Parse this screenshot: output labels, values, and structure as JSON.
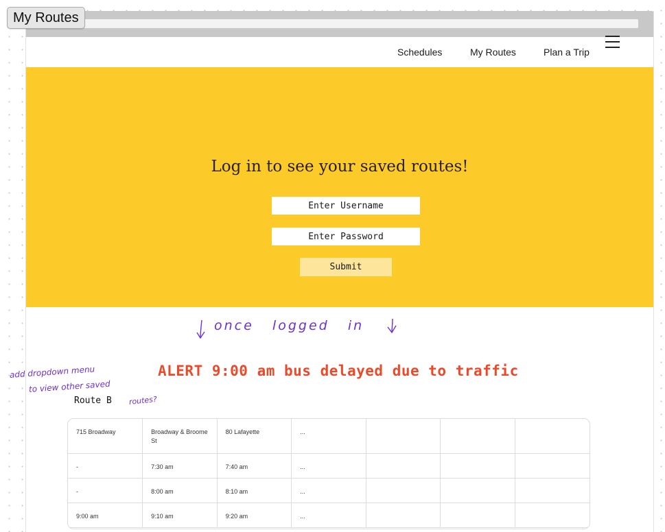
{
  "window": {
    "title": "My Routes"
  },
  "nav": {
    "links": [
      "Schedules",
      "My Routes",
      "Plan a Trip"
    ]
  },
  "login": {
    "heading": "Log in to see your saved routes!",
    "username_placeholder": "Enter Username",
    "password_placeholder": "Enter Password",
    "submit_label": "Submit"
  },
  "annotations": {
    "once_logged_in": "once   logged   in",
    "dropdown_note_line1": "add dropdown menu",
    "dropdown_note_line2": "to view other saved",
    "dropdown_note_line3": "routes?"
  },
  "alert": {
    "text": "ALERT 9:00 am bus delayed due to traffic"
  },
  "route": {
    "label": "Route B",
    "headers": [
      "715 Broadway",
      "Broadway & Broome St",
      "80 Lafayette",
      "...",
      "",
      "",
      ""
    ],
    "rows": [
      [
        "-",
        "7:30 am",
        "7:40 am",
        "...",
        "",
        "",
        ""
      ],
      [
        "-",
        "8:00 am",
        "8:10 am",
        "...",
        "",
        "",
        ""
      ],
      [
        "9:00 am",
        "9:10 am",
        "9:20 am",
        "...",
        "",
        "",
        ""
      ]
    ]
  },
  "colors": {
    "hero": "#fdcb29",
    "alert": "#ea4a29",
    "annotation": "#6b31d1",
    "submit_bg": "#fde59c"
  }
}
